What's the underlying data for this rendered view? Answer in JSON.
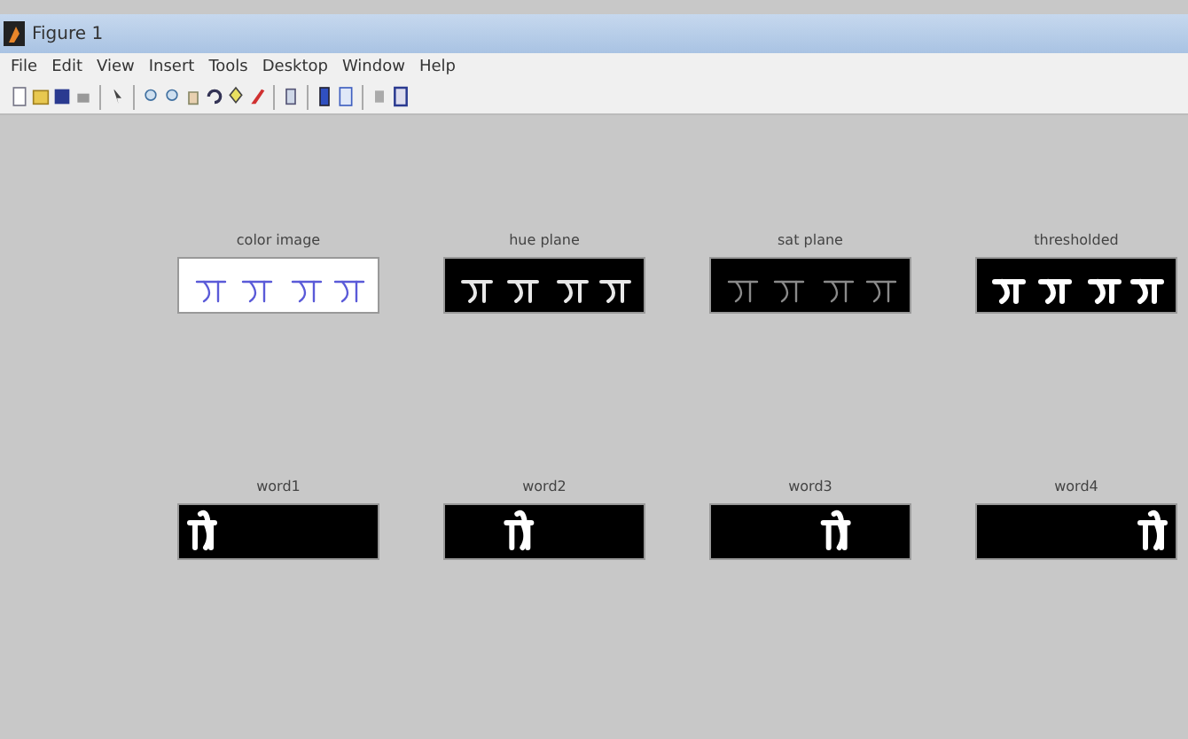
{
  "window": {
    "title": "Figure 1"
  },
  "menu": [
    "File",
    "Edit",
    "View",
    "Insert",
    "Tools",
    "Desktop",
    "Window",
    "Help"
  ],
  "plots": [
    {
      "title": "color image",
      "kind": "color"
    },
    {
      "title": "hue plane",
      "kind": "hue"
    },
    {
      "title": "sat plane",
      "kind": "sat"
    },
    {
      "title": "thresholded",
      "kind": "threshold"
    },
    {
      "title": "word1",
      "kind": "word"
    },
    {
      "title": "word2",
      "kind": "word"
    },
    {
      "title": "word3",
      "kind": "word"
    },
    {
      "title": "word4",
      "kind": "word"
    }
  ]
}
